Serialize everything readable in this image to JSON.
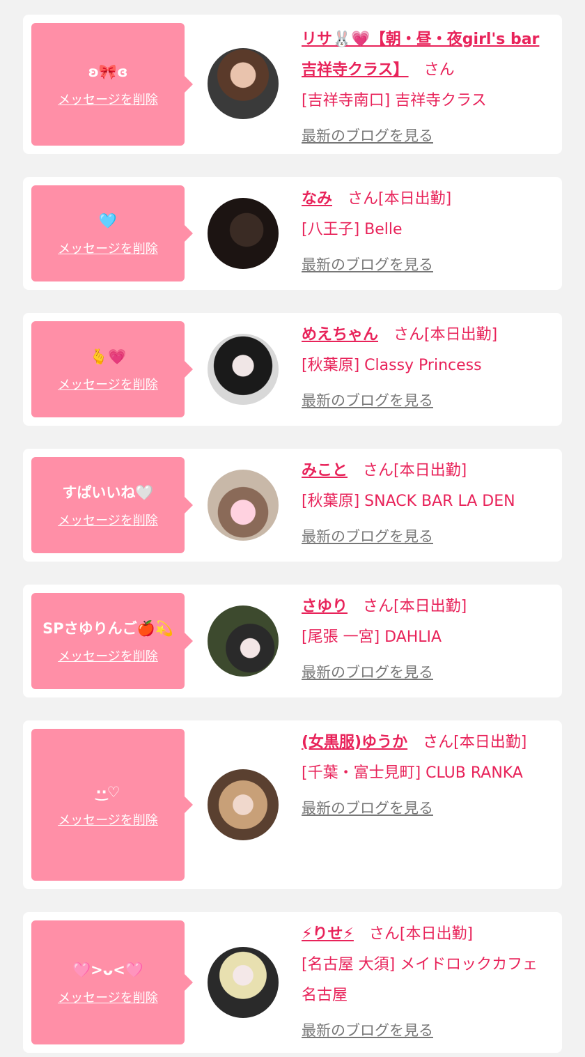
{
  "cards": [
    {
      "message": "ʚ🎀ɞ",
      "delete_label": "メッセージを削除",
      "name": "リサ🐰💗【朝・昼・夜girl's bar吉祥寺クラス】",
      "suffix": "さん",
      "location": "[吉祥寺南口] 吉祥寺クラス",
      "blog_label": "最新のブログを見る"
    },
    {
      "message": "🩵",
      "delete_label": "メッセージを削除",
      "name": "なみ",
      "suffix": "さん[本日出勤]",
      "location": "[八王子] Belle",
      "blog_label": "最新のブログを見る"
    },
    {
      "message": "🫰💗",
      "delete_label": "メッセージを削除",
      "name": "めえちゃん",
      "suffix": "さん[本日出勤]",
      "location": "[秋葉原] Classy Princess",
      "blog_label": "最新のブログを見る"
    },
    {
      "message": "すぱいいね🤍",
      "delete_label": "メッセージを削除",
      "name": "みこと",
      "suffix": "さん[本日出勤]",
      "location": "[秋葉原] SNACK BAR LA DEN",
      "blog_label": "最新のブログを見る"
    },
    {
      "message": "SPさゆりんご🍎💫",
      "delete_label": "メッセージを削除",
      "name": "さゆり",
      "suffix": "さん[本日出勤]",
      "location": "[尾張 一宮] DAHLIA",
      "blog_label": "最新のブログを見る"
    },
    {
      "message": "·͜·♡",
      "delete_label": "メッセージを削除",
      "name": "(女黒服)ゆうか",
      "suffix": "さん[本日出勤]",
      "location": "[千葉・富士見町] CLUB RANKA",
      "blog_label": "最新のブログを見る"
    },
    {
      "message": "🩷>ᴗ<🩷",
      "delete_label": "メッセージを削除",
      "name": "⚡りせ⚡",
      "suffix": "さん[本日出勤]",
      "location": "[名古屋 大須] メイドロックカフェ名古屋",
      "blog_label": "最新のブログを見る"
    }
  ],
  "colors": {
    "accent": "#e8235a",
    "bubble": "#ff8fa7",
    "background": "#f2f2f2",
    "link_gray": "#777777"
  }
}
